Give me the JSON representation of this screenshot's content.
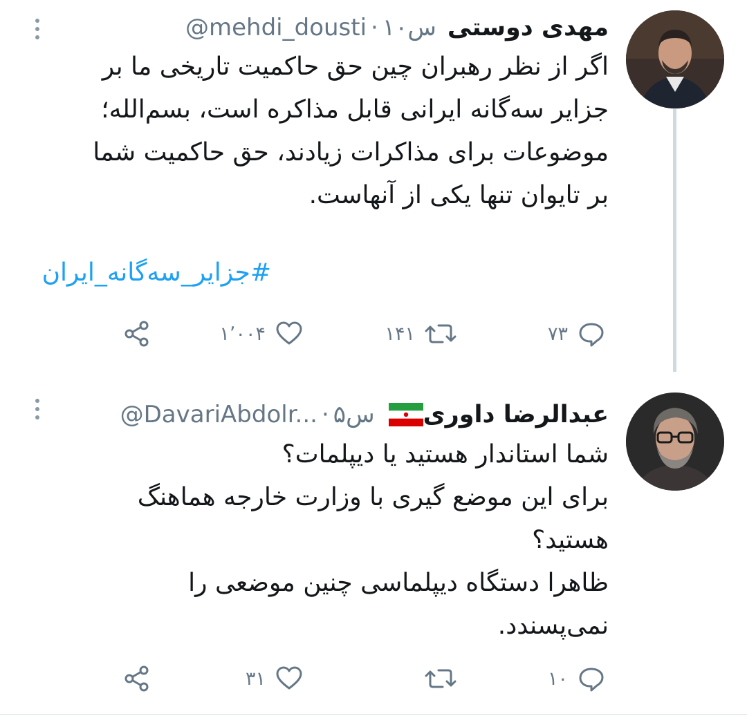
{
  "tweets": [
    {
      "display_name": "مهدی دوستی",
      "handle": "@mehdi_dousti",
      "time": "۱۰س",
      "text_lines": [
        "اگر از نظر رهبران چین حق حاکمیت تاریخی ما بر",
        "جزایر سه‌گانه ایرانی قابل مذاکره است، بسم‌الله؛",
        "موضوعات برای مذاکرات زیادند، حق حاکمیت شما",
        "بر تایوان تنها یکی از آنهاست."
      ],
      "hashtag": "#جزایر_سه‌گانه_ایران",
      "reply_count": "۷۳",
      "retweet_count": "۱۴۱",
      "like_count": "۱٬۰۰۴",
      "avatar_icon": "avatar-photo"
    },
    {
      "display_name": "عبدالرضا داوری",
      "flag_icon": "iran-flag-icon",
      "handle": "@DavariAbdolr...",
      "time": "۵س",
      "text_lines": [
        "شما استاندار هستید یا دیپلمات؟",
        "برای این موضع گیری با وزارت خارجه هماهنگ",
        "هستید؟",
        "ظاهرا دستگاه دیپلماسی چنین موضعی را",
        "نمی‌پسندد."
      ],
      "reply_count": "۱۰",
      "retweet_count": "",
      "like_count": "۳۱",
      "avatar_icon": "avatar-photo"
    }
  ],
  "meta_separator": "·",
  "colors": {
    "text": "#14171a",
    "secondary": "#657786",
    "link": "#1da1f2",
    "thread_line": "#cfd9de"
  },
  "icons": {
    "reply": "reply-icon",
    "retweet": "retweet-icon",
    "like": "heart-icon",
    "share": "share-icon",
    "more": "more-options-icon"
  }
}
